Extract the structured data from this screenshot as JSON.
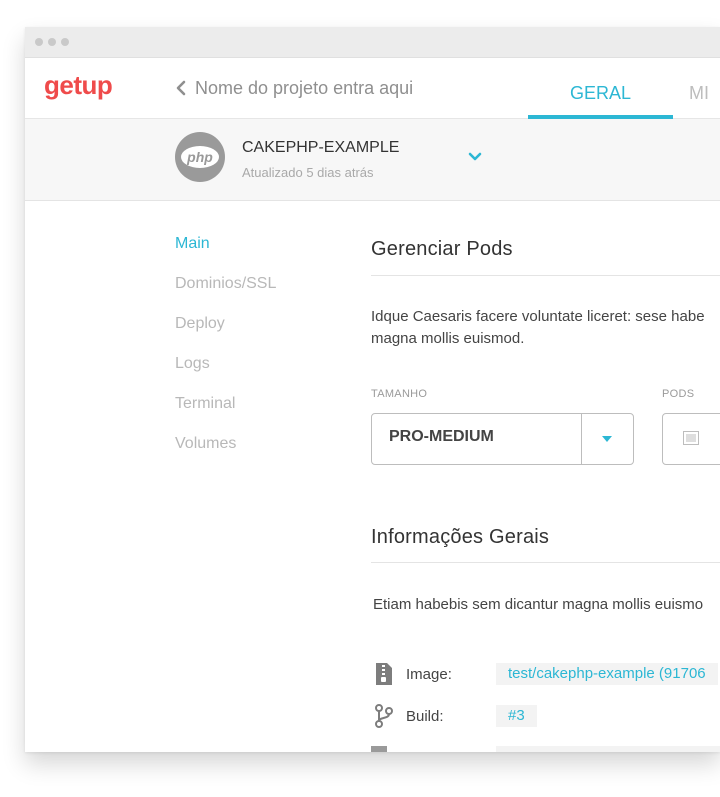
{
  "header": {
    "logo": "getup",
    "back_label": "Nome do projeto entra aqui",
    "tabs": [
      {
        "label": "GERAL",
        "active": true
      },
      {
        "label": "MI",
        "active": false
      }
    ]
  },
  "project": {
    "badge_text": "php",
    "name": "CAKEPHP-EXAMPLE",
    "updated": "Atualizado 5 dias atrás"
  },
  "sidebar": {
    "items": [
      {
        "label": "Main",
        "active": true
      },
      {
        "label": "Dominios/SSL",
        "active": false
      },
      {
        "label": "Deploy",
        "active": false
      },
      {
        "label": "Logs",
        "active": false
      },
      {
        "label": "Terminal",
        "active": false
      },
      {
        "label": "Volumes",
        "active": false
      }
    ]
  },
  "pods_section": {
    "title": "Gerenciar Pods",
    "description_line1": "Idque Caesaris facere voluntate liceret: sese habe",
    "description_line2": "magna mollis euismod.",
    "size_label": "TAMANHO",
    "size_value": "PRO-MEDIUM",
    "pods_label": "PODS"
  },
  "info_section": {
    "title": "Informações Gerais",
    "description": "Etiam habebis sem dicantur magna mollis euismo",
    "rows": [
      {
        "label": "Image:",
        "value": "test/cakephp-example (91706",
        "icon": "zip-file-icon"
      },
      {
        "label": "Build:",
        "value": "#3",
        "icon": "branch-icon"
      }
    ]
  },
  "colors": {
    "accent": "#2cb7d4",
    "logo": "#ef4b4b",
    "muted_text": "#b8b8b8"
  }
}
